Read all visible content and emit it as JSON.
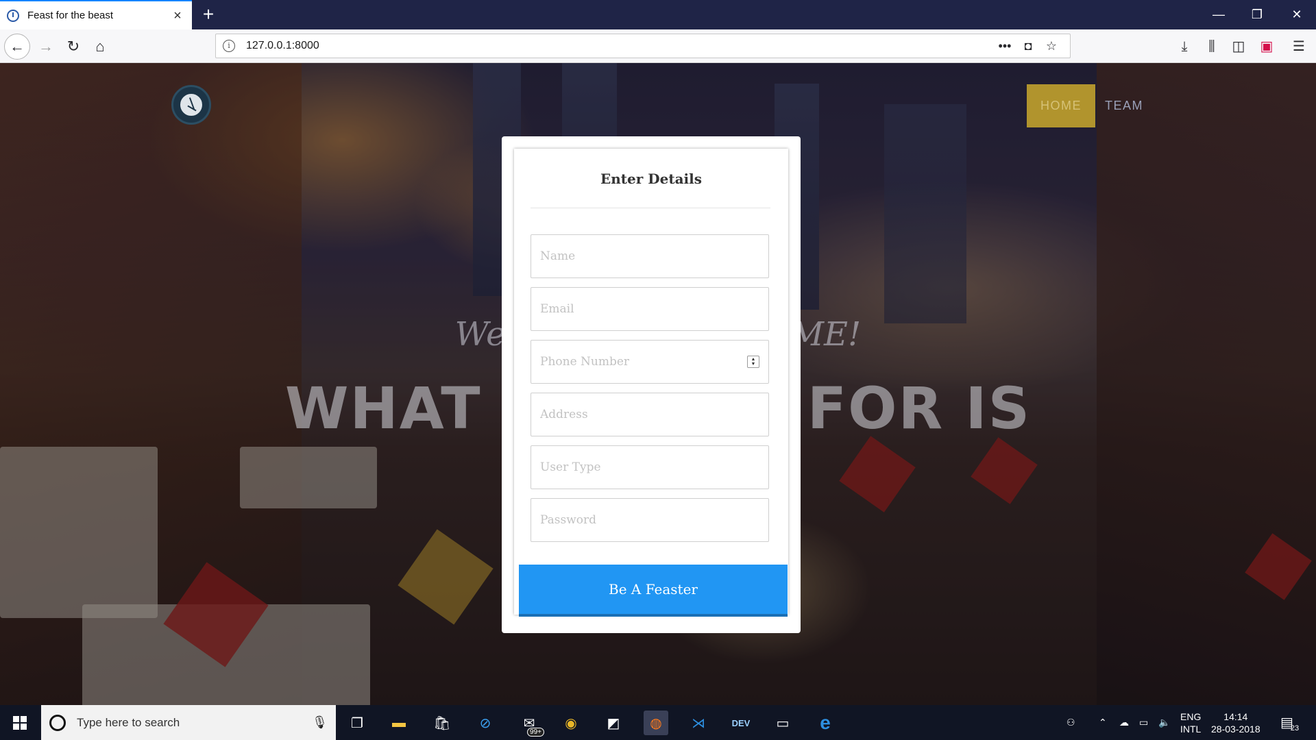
{
  "browser": {
    "tab_title": "Feast for the beast",
    "url": "127.0.0.1:8000"
  },
  "site": {
    "nav": {
      "home": "HOME",
      "team": "TEAM"
    },
    "hero_subtitle_left": "Wel",
    "hero_subtitle_right": "ME!",
    "hero_title_left": "WHAT YO",
    "hero_title_right": "E FOR IS"
  },
  "form": {
    "title": "Enter Details",
    "fields": {
      "name": "Name",
      "email": "Email",
      "phone": "Phone Number",
      "address": "Address",
      "user_type": "User Type",
      "password": "Password"
    },
    "submit": "Be A Feaster"
  },
  "taskbar": {
    "search_placeholder": "Type here to search",
    "mail_badge": "99+",
    "lang_top": "ENG",
    "lang_bottom": "INTL",
    "time": "14:14",
    "date": "28-03-2018",
    "notification_count": "23"
  },
  "colors": {
    "accent_blue": "#2196f3",
    "nav_gold": "#b1942d",
    "browser_tab_accent": "#0a84ff"
  }
}
